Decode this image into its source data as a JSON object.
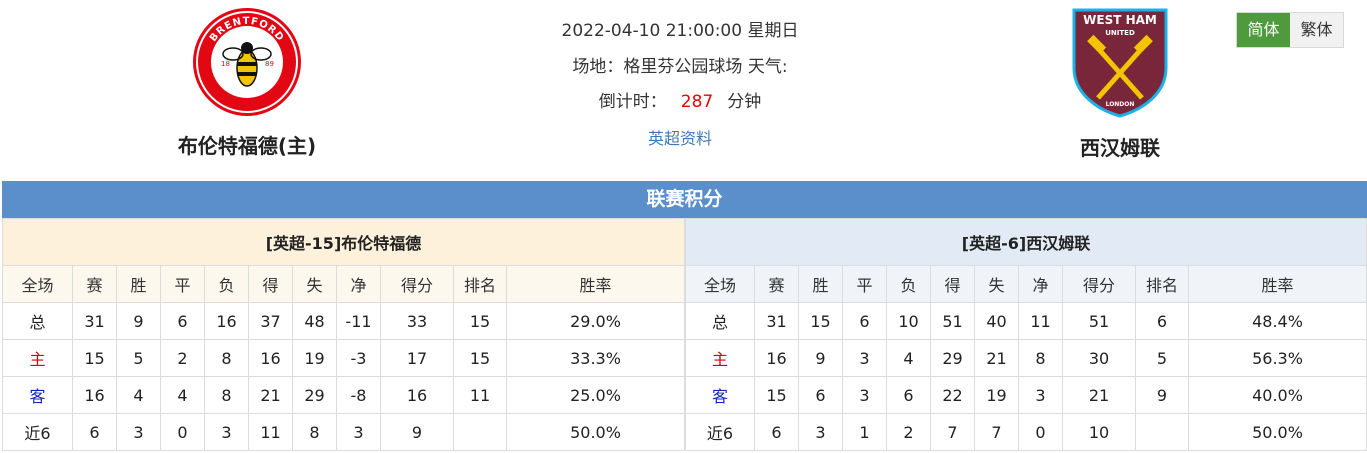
{
  "header": {
    "home_team": "布伦特福德(主)",
    "away_team": "西汉姆联",
    "datetime": "2022-04-10 21:00:00 星期日",
    "venue_label": "场地：",
    "venue": "格里芬公园球场",
    "weather_label": "天气:",
    "countdown_label": "倒计时：",
    "countdown_value": "287",
    "countdown_unit": "分钟",
    "league_link": "英超资料"
  },
  "logos": {
    "home_text_top": "BRENTFORD",
    "home_text_bottom": "FOOTBALL CLUB",
    "home_year_left": "18",
    "home_year_right": "89",
    "away_text_top": "WEST HAM",
    "away_text_mid": "UNITED",
    "away_text_bottom": "LONDON"
  },
  "lang": {
    "simplified": "简体",
    "traditional": "繁体"
  },
  "standings": {
    "title": "联赛积分",
    "columns": [
      "全场",
      "赛",
      "胜",
      "平",
      "负",
      "得",
      "失",
      "净",
      "得分",
      "排名",
      "胜率"
    ],
    "home": {
      "caption": "[英超-15]布伦特福德",
      "rows": [
        [
          "总",
          "31",
          "9",
          "6",
          "16",
          "37",
          "48",
          "-11",
          "33",
          "15",
          "29.0%"
        ],
        [
          "主",
          "15",
          "5",
          "2",
          "8",
          "16",
          "19",
          "-3",
          "17",
          "15",
          "33.3%"
        ],
        [
          "客",
          "16",
          "4",
          "4",
          "8",
          "21",
          "29",
          "-8",
          "16",
          "11",
          "25.0%"
        ],
        [
          "近6",
          "6",
          "3",
          "0",
          "3",
          "11",
          "8",
          "3",
          "9",
          "",
          "50.0%"
        ]
      ]
    },
    "away": {
      "caption": "[英超-6]西汉姆联",
      "rows": [
        [
          "总",
          "31",
          "15",
          "6",
          "10",
          "51",
          "40",
          "11",
          "51",
          "6",
          "48.4%"
        ],
        [
          "主",
          "16",
          "9",
          "3",
          "4",
          "29",
          "21",
          "8",
          "30",
          "5",
          "56.3%"
        ],
        [
          "客",
          "15",
          "6",
          "3",
          "6",
          "22",
          "19",
          "3",
          "21",
          "9",
          "40.0%"
        ],
        [
          "近6",
          "6",
          "3",
          "1",
          "2",
          "7",
          "7",
          "0",
          "10",
          "",
          "50.0%"
        ]
      ]
    }
  },
  "colors": {
    "title_bar": "#5b8fcb",
    "countdown": "#e00000",
    "link": "#3f78b8",
    "lang_active": "#4f9a3d"
  }
}
